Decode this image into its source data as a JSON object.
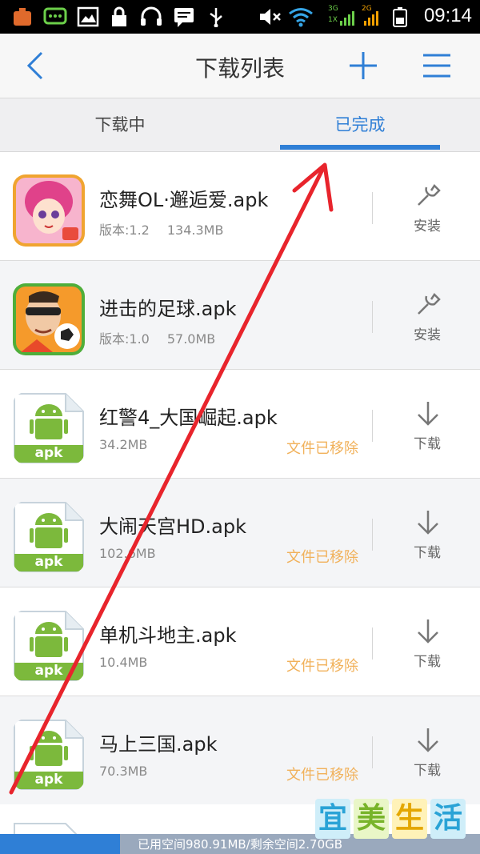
{
  "status_bar": {
    "time": "09:14",
    "signal_1_label": "3G",
    "signal_2_label": "1X",
    "signal_3_label": "2G"
  },
  "header": {
    "title": "下载列表"
  },
  "tabs": [
    {
      "label": "下载中",
      "active": false
    },
    {
      "label": "已完成",
      "active": true
    }
  ],
  "items": [
    {
      "name": "恋舞OL·邂逅爱.apk",
      "version": "版本:1.2",
      "size": "134.3MB",
      "status": "",
      "action": "安装",
      "action_icon": "wrench-icon",
      "icon": "game-girl-icon"
    },
    {
      "name": "进击的足球.apk",
      "version": "版本:1.0",
      "size": "57.0MB",
      "status": "",
      "action": "安装",
      "action_icon": "wrench-icon",
      "icon": "soccer-game-icon"
    },
    {
      "name": "红警4_大国崛起.apk",
      "version": "",
      "size": "34.2MB",
      "status": "文件已移除",
      "action": "下载",
      "action_icon": "download-arrow-icon",
      "icon": "apk-file-icon"
    },
    {
      "name": "大闹天宫HD.apk",
      "version": "",
      "size": "102.6MB",
      "status": "文件已移除",
      "action": "下载",
      "action_icon": "download-arrow-icon",
      "icon": "apk-file-icon"
    },
    {
      "name": "单机斗地主.apk",
      "version": "",
      "size": "10.4MB",
      "status": "文件已移除",
      "action": "下载",
      "action_icon": "download-arrow-icon",
      "icon": "apk-file-icon"
    },
    {
      "name": "马上三国.apk",
      "version": "",
      "size": "70.3MB",
      "status": "文件已移除",
      "action": "下载",
      "action_icon": "download-arrow-icon",
      "icon": "apk-file-icon"
    }
  ],
  "apk_label": "apk",
  "storage": {
    "text": "已用空间980.91MB/剩余空间2.70GB",
    "used_fraction": 0.25
  },
  "watermark": {
    "chars": [
      "宜",
      "美",
      "生",
      "活"
    ]
  },
  "colors": {
    "accent": "#2f7fd6",
    "removed_status": "#f1b15a",
    "annotation_arrow": "#e8242c"
  }
}
